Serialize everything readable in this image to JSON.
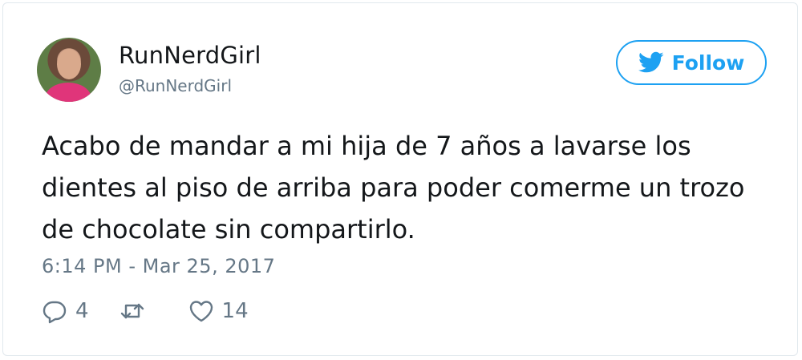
{
  "user": {
    "display_name": "RunNerdGirl",
    "handle": "@RunNerdGirl",
    "avatar_icon": "profile-photo"
  },
  "follow_button": {
    "label": "Follow",
    "icon": "twitter-bird-icon",
    "color": "#1da1f2"
  },
  "tweet": {
    "text": "Acabo de mandar a mi hija de 7 años a lavarse los dientes al piso de arriba para poder comerme un trozo de chocolate sin compartirlo.",
    "timestamp": "6:14 PM - Mar 25, 2017"
  },
  "actions": {
    "reply_count": "4",
    "retweet_count": "",
    "like_count": "14"
  },
  "colors": {
    "text": "#14171a",
    "secondary": "#657786",
    "accent": "#1da1f2",
    "border": "#e1e8ed"
  }
}
